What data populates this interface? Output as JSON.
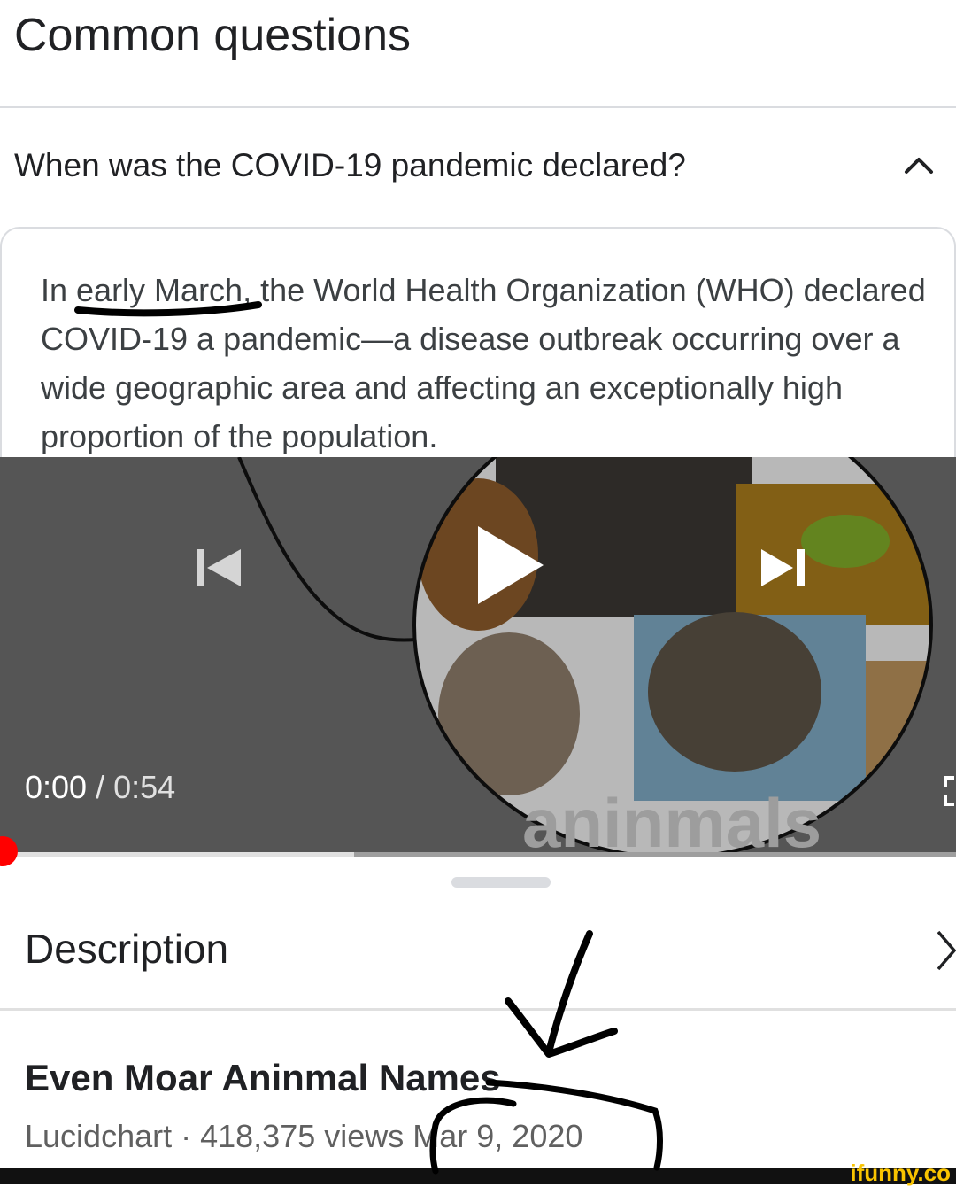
{
  "section": {
    "title": "Common questions"
  },
  "question": {
    "text": "When was the COVID-19 pandemic declared?",
    "answer": "In early March, the World Health Organization (WHO) declared COVID-19 a pandemic—a disease outbreak occurring over a wide geographic area and affecting an exceptionally high proportion of the population."
  },
  "player": {
    "current_time": "0:00",
    "separator": " / ",
    "duration": "0:54",
    "thumbnail_text": "aninmals",
    "progress": 0.37
  },
  "description": {
    "label": "Description"
  },
  "video": {
    "title": "Even Moar Aninmal Names",
    "channel": "Lucidchart",
    "views": "418,375 views",
    "dot": " · ",
    "date": "Mar 9, 2020"
  },
  "watermark": {
    "text": "ifunny.co"
  },
  "colors": {
    "progress_red": "#ff0000",
    "watermark_yellow": "#f9c400"
  }
}
